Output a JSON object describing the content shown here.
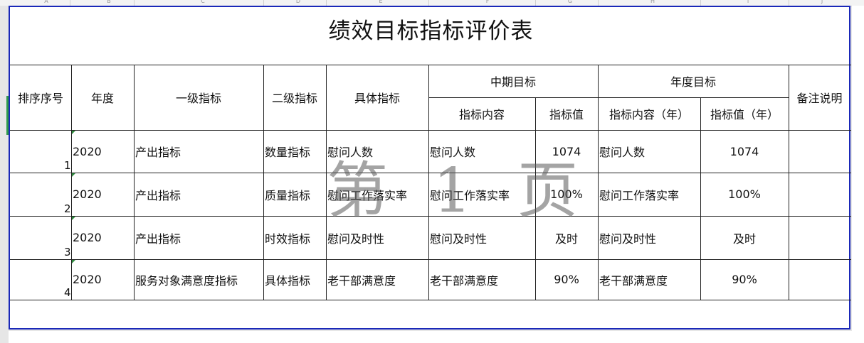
{
  "column_letters": [
    "A",
    "B",
    "C",
    "D",
    "E",
    "F",
    "G",
    "H",
    "I",
    "J"
  ],
  "title": "绩效目标指标评价表",
  "headers": {
    "seq": "排序序号",
    "year": "年度",
    "level1": "一级指标",
    "level2": "二级指标",
    "specific": "具体指标",
    "mid_term": "中期目标",
    "annual": "年度目标",
    "remark": "备注说明",
    "mid_content": "指标内容",
    "mid_value": "指标值",
    "annual_content": "指标内容（年）",
    "annual_value": "指标值（年）"
  },
  "rows": [
    {
      "seq": "1",
      "year": "2020",
      "level1": "产出指标",
      "level2": "数量指标",
      "specific": "慰问人数",
      "mid_content": "慰问人数",
      "mid_value": "1074",
      "annual_content": "慰问人数",
      "annual_value": "1074",
      "remark": ""
    },
    {
      "seq": "2",
      "year": "2020",
      "level1": "产出指标",
      "level2": "质量指标",
      "specific": "慰问工作落实率",
      "mid_content": "慰问工作落实率",
      "mid_value": "100%",
      "annual_content": "慰问工作落实率",
      "annual_value": "100%",
      "remark": ""
    },
    {
      "seq": "3",
      "year": "2020",
      "level1": "产出指标",
      "level2": "时效指标",
      "specific": "慰问及时性",
      "mid_content": "慰问及时性",
      "mid_value": "及时",
      "annual_content": "慰问及时性",
      "annual_value": "及时",
      "remark": ""
    },
    {
      "seq": "4",
      "year": "2020",
      "level1": "服务对象满意度指标",
      "level2": "具体指标",
      "specific": "老干部满意度",
      "mid_content": "老干部满意度",
      "mid_value": "90%",
      "annual_content": "老干部满意度",
      "annual_value": "90%",
      "remark": ""
    }
  ],
  "watermark": "第 1 页"
}
